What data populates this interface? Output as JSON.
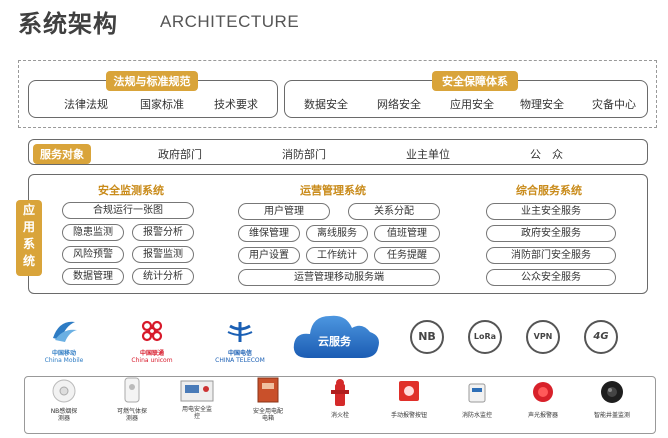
{
  "header": {
    "title": "系统架构",
    "subtitle": "ARCHITECTURE"
  },
  "regulation": {
    "tag": "法规与标准规范",
    "items": [
      "法律法规",
      "国家标准",
      "技术要求"
    ]
  },
  "security": {
    "tag": "安全保障体系",
    "items": [
      "数据安全",
      "网络安全",
      "应用安全",
      "物理安全",
      "灾备中心"
    ]
  },
  "service_targets": {
    "tag": "服务对象",
    "items": [
      "政府部门",
      "消防部门",
      "业主单位",
      "公　众"
    ]
  },
  "app_system": {
    "tag": "应用系统"
  },
  "monitoring": {
    "title": "安全监测系统",
    "items": [
      "合规运行一张图",
      "隐患监测",
      "报警分析",
      "风险预警",
      "报警监测",
      "数据管理",
      "统计分析"
    ]
  },
  "operations": {
    "title": "运营管理系统",
    "items": [
      "用户管理",
      "关系分配",
      "维保管理",
      "离线服务",
      "值班管理",
      "用户设置",
      "工作统计",
      "任务提醒",
      "运营管理移动服务端"
    ]
  },
  "integrated": {
    "title": "综合服务系统",
    "items": [
      "业主安全服务",
      "政府安全服务",
      "消防部门安全服务",
      "公众安全服务"
    ]
  },
  "network": {
    "carriers": [
      {
        "name": "中国移动",
        "en": "China Mobile",
        "color": "#2e7cc4"
      },
      {
        "name": "中国联通",
        "en": "China unicom",
        "color": "#d7192a"
      },
      {
        "name": "中国电信",
        "en": "CHINA TELECOM",
        "color": "#1a5fb4"
      }
    ],
    "cloud": "云服务",
    "protocols": [
      "NB",
      "LoRa",
      "VPN",
      "4G"
    ]
  },
  "devices": [
    "NB感烟探测器",
    "可燃气体探测器",
    "用电安全监控",
    "安全用电配电箱",
    "消火栓",
    "手动报警按钮",
    "消防水监控",
    "声光报警器",
    "智能井盖监测"
  ],
  "colors": {
    "accent": "#d9a43a",
    "accent_text": "#c98b1a",
    "cloud": "#2a72c8"
  }
}
